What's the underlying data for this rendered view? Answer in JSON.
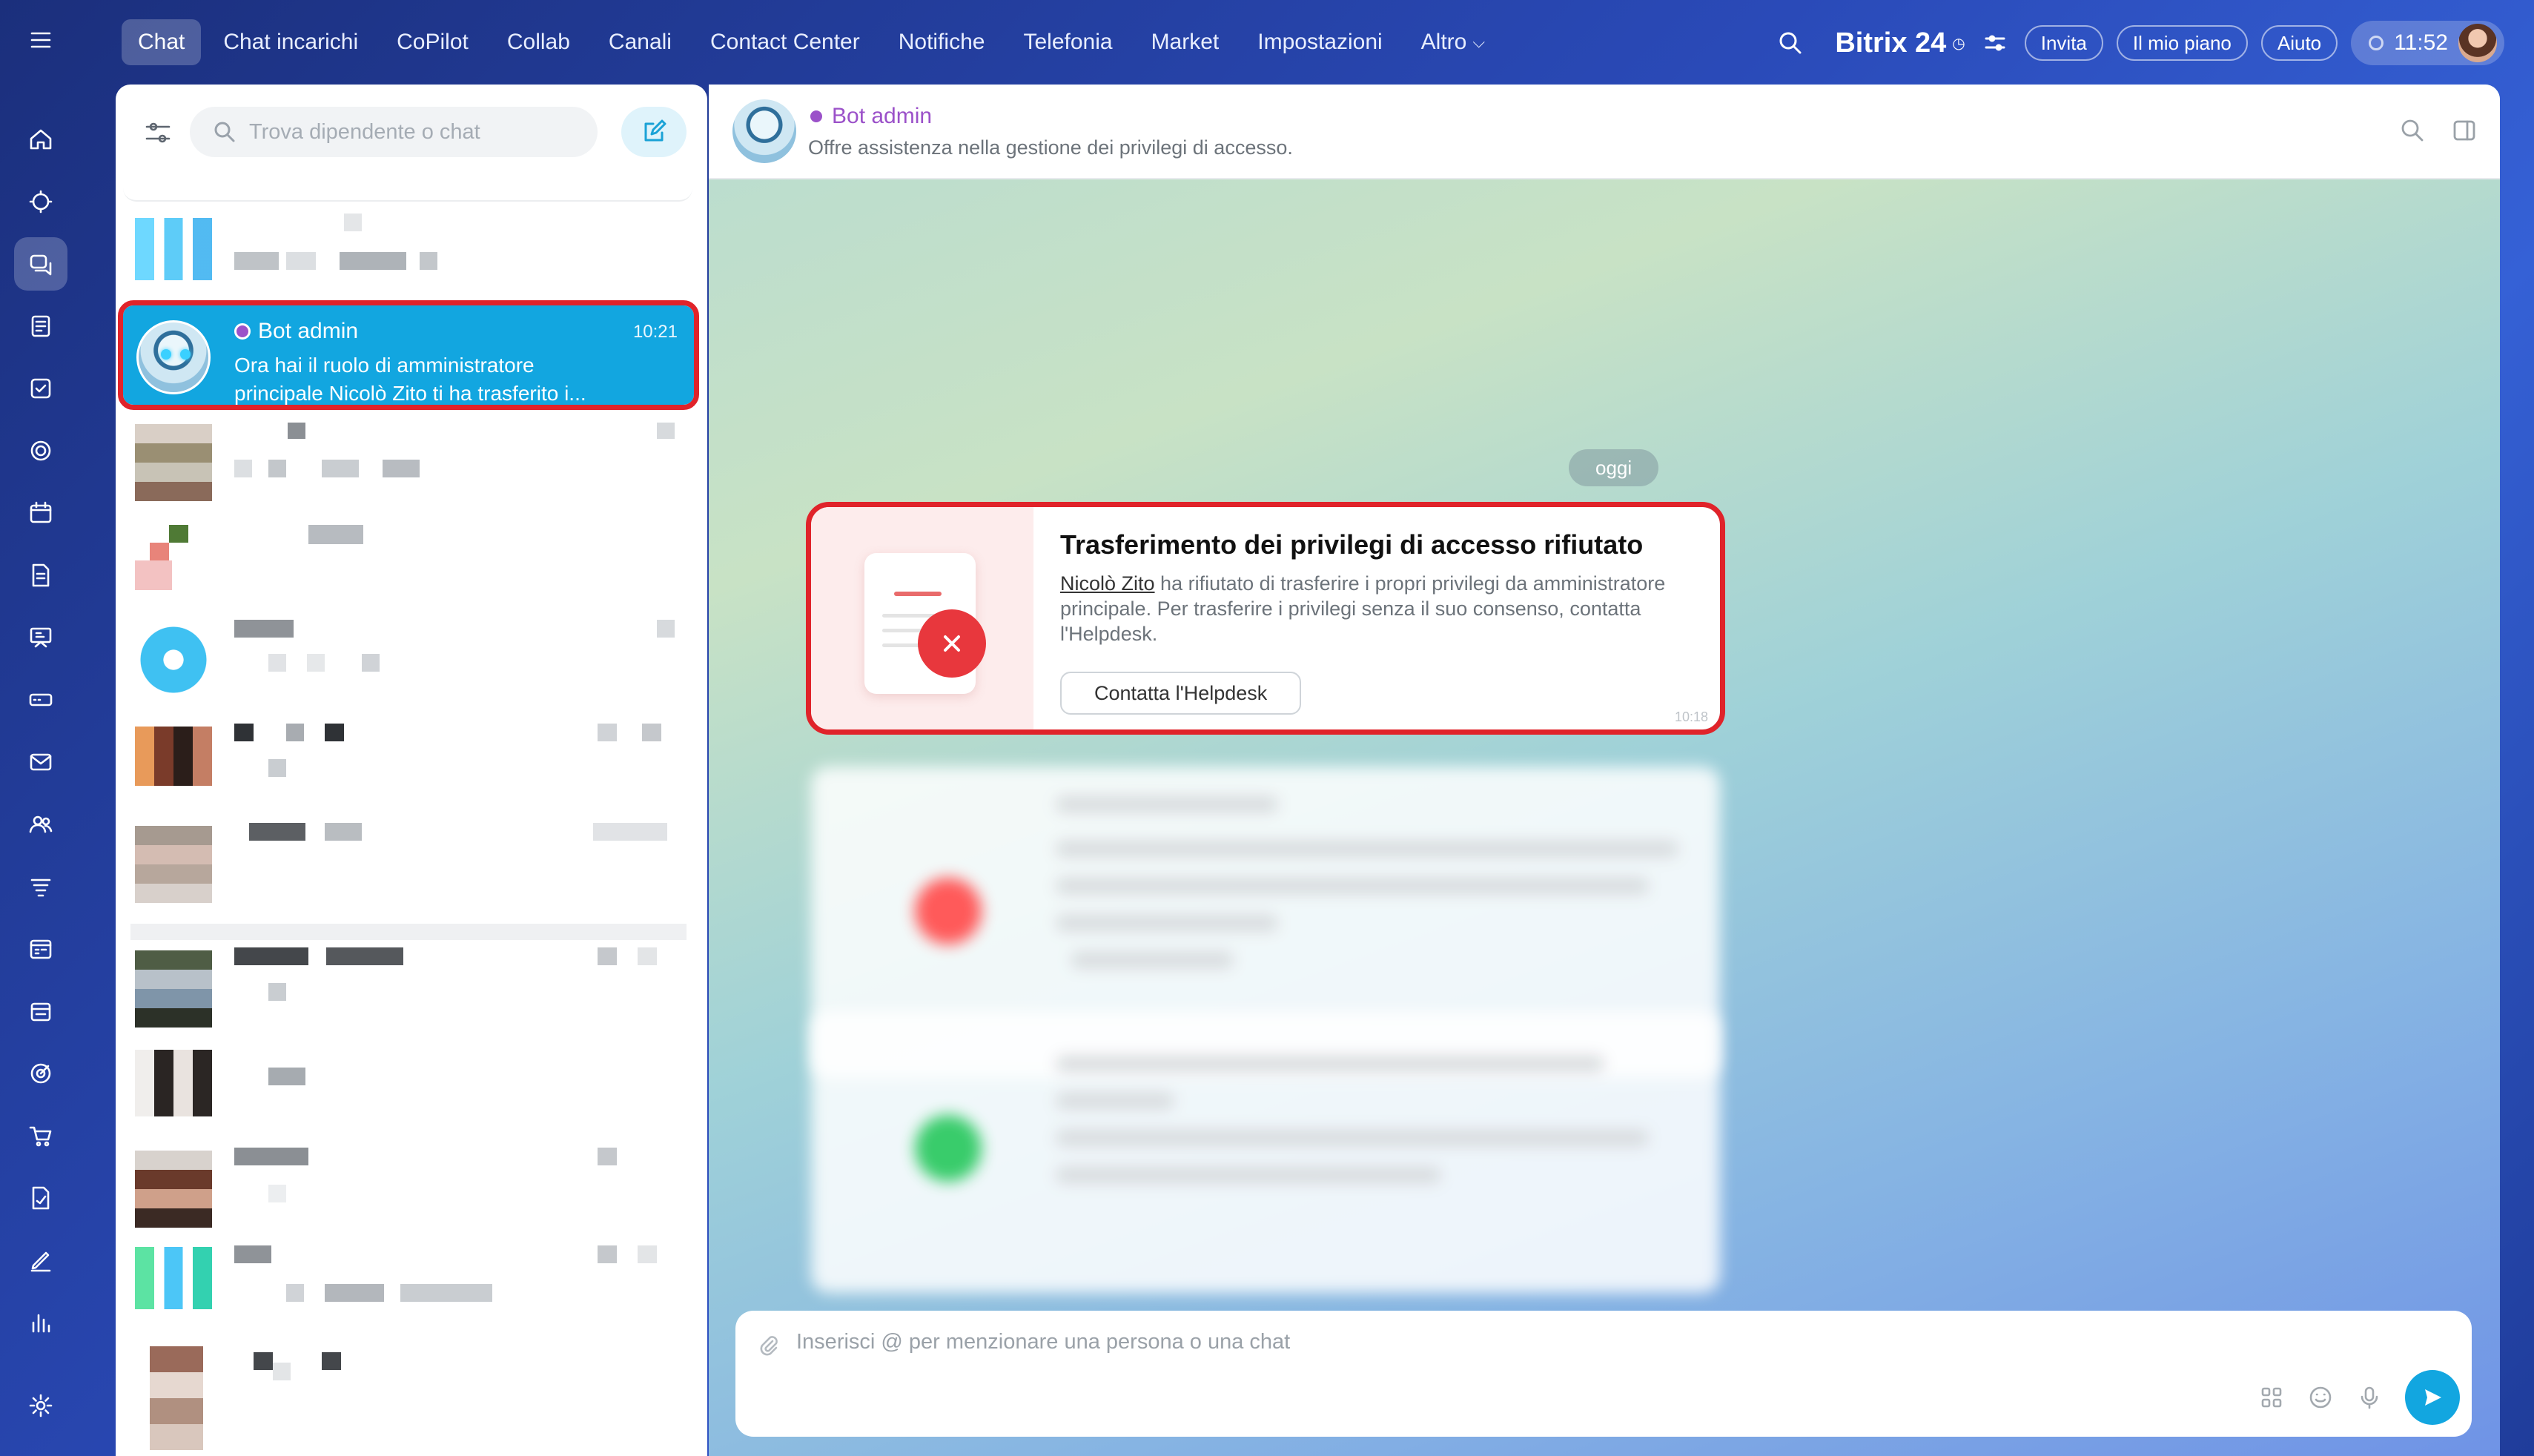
{
  "nav": {
    "items": [
      "Chat",
      "Chat incarichi",
      "CoPilot",
      "Collab",
      "Canali",
      "Contact Center",
      "Notifiche",
      "Telefonia",
      "Market",
      "Impostazioni"
    ],
    "more_label": "Altro",
    "active": "Chat"
  },
  "topbar": {
    "brand": "Bitrix 24",
    "invite_label": "Invita",
    "plan_label": "Il mio piano",
    "help_label": "Aiuto",
    "clock": "11:52"
  },
  "sidebar_icons": [
    "menu-icon",
    "home-icon",
    "copilot-icon",
    "chat-icon",
    "feed-icon",
    "tasks-icon",
    "collab-icon",
    "calendar-icon",
    "documents-icon",
    "boards-icon",
    "drive-icon",
    "mail-icon",
    "groups-icon",
    "crm-icon",
    "booking-icon",
    "store-icon",
    "marketing-icon",
    "shop-icon",
    "sign-icon",
    "editor-icon",
    "analytics-icon",
    "settings-icon"
  ],
  "chat_list": {
    "search_placeholder": "Trova dipendente o chat",
    "selected": {
      "name": "Bot admin",
      "time": "10:21",
      "preview_line1": "Ora hai il ruolo di amministratore",
      "preview_line2": "principale Nicolò Zito ti ha trasferito i..."
    }
  },
  "chat": {
    "title": "Bot admin",
    "subtitle": "Offre assistenza nella gestione dei privilegi di accesso.",
    "date_divider": "oggi",
    "message": {
      "title": "Trasferimento dei privilegi di accesso rifiutato",
      "user": "Nicolò Zito",
      "body_line1": " ha rifiutato di trasferire i propri privilegi da amministratore",
      "body_line2": "principale. Per trasferire i privilegi senza il suo consenso, contatta",
      "body_line3": "l'Helpdesk.",
      "button": "Contatta l'Helpdesk",
      "time": "10:18"
    },
    "composer_placeholder": "Inserisci @ per menzionare una persona o una chat"
  },
  "colors": {
    "accent": "#12a6e0",
    "highlight": "#e0232a",
    "bot_badge": "#9b51c9",
    "error": "#e8373d"
  }
}
